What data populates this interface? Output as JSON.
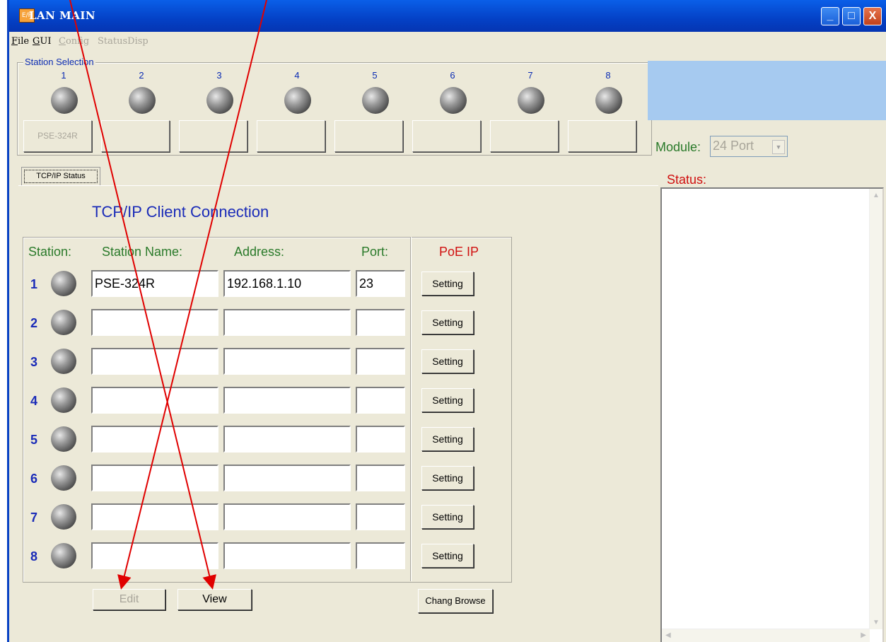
{
  "window": {
    "title": "LAN MAIN",
    "icon_text": "E/P"
  },
  "titlebar_buttons": {
    "minimize": "_",
    "maximize": "□",
    "close": "X"
  },
  "menu": [
    {
      "label_first": "F",
      "label_rest": "ile",
      "enabled": true
    },
    {
      "label_first": "G",
      "label_rest": "UI",
      "enabled": true
    },
    {
      "label_first": "C",
      "label_rest": "onfig",
      "enabled": false
    },
    {
      "label_first": "",
      "label_rest": "StatusDisp",
      "enabled": false
    }
  ],
  "station_selection": {
    "legend": "Station Selection",
    "stations": [
      {
        "num": "1",
        "button": "PSE-324R"
      },
      {
        "num": "2",
        "button": ""
      },
      {
        "num": "3",
        "button": ""
      },
      {
        "num": "4",
        "button": ""
      },
      {
        "num": "5",
        "button": ""
      },
      {
        "num": "6",
        "button": ""
      },
      {
        "num": "7",
        "button": ""
      },
      {
        "num": "8",
        "button": ""
      }
    ]
  },
  "module": {
    "label": "Module:",
    "value": "24 Port"
  },
  "tab": {
    "label": "TCP/IP Status"
  },
  "status": {
    "label": "Status:",
    "text": ""
  },
  "client": {
    "heading": "TCP/IP Client Connection",
    "headers": {
      "station": "Station:",
      "name": "Station Name:",
      "address": "Address:",
      "port": "Port:",
      "poe": "PoE IP"
    },
    "rows": [
      {
        "num": "1",
        "name": "PSE-324R",
        "address": "192.168.1.10",
        "port": "23",
        "button": "Setting"
      },
      {
        "num": "2",
        "name": "",
        "address": "",
        "port": "",
        "button": "Setting"
      },
      {
        "num": "3",
        "name": "",
        "address": "",
        "port": "",
        "button": "Setting"
      },
      {
        "num": "4",
        "name": "",
        "address": "",
        "port": "",
        "button": "Setting"
      },
      {
        "num": "5",
        "name": "",
        "address": "",
        "port": "",
        "button": "Setting"
      },
      {
        "num": "6",
        "name": "",
        "address": "",
        "port": "",
        "button": "Setting"
      },
      {
        "num": "7",
        "name": "",
        "address": "",
        "port": "",
        "button": "Setting"
      },
      {
        "num": "8",
        "name": "",
        "address": "",
        "port": "",
        "button": "Setting"
      }
    ]
  },
  "buttons": {
    "edit": "Edit",
    "view": "View",
    "chang_browse": "Chang Browse"
  },
  "annotation": {
    "arrow_color": "#e00000"
  }
}
